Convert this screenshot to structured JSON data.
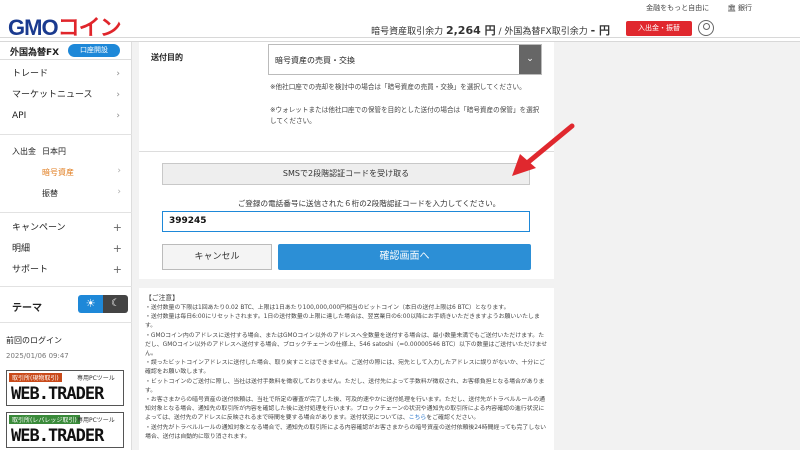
{
  "header": {
    "logo_gmo": "GMO",
    "logo_coin": "コイン",
    "top_links": [
      "金融をもっと自由に",
      "銀行"
    ],
    "balance_label_1": "暗号資産取引余力",
    "balance_value_1": "2,264 円",
    "balance_sep": "/",
    "balance_label_2": "外国為替FX取引余力",
    "balance_value_2": "- 円",
    "deposit_label": "入出金・振替"
  },
  "sidebar": {
    "fx_title": "外国為替FX",
    "open_account": "口座開設",
    "items": [
      "トレード",
      "マーケットニュース",
      "API"
    ],
    "deposit_section": "入出金",
    "deposit_jpy": "日本円",
    "deposit_crypto": "暗号資産",
    "transfer": "振替",
    "campaign": "キャンペーン",
    "statement": "明細",
    "support": "サポート",
    "theme_label": "テーマ",
    "last_login_label": "前回のログイン",
    "last_login_date": "2025/01/06 09:47",
    "banners": [
      {
        "tag": "取引所(現物取引)",
        "pc": "専用PCツール",
        "name": "WEB.TRADER"
      },
      {
        "tag": "取引所(レバレッジ取引)",
        "pc": "専用PCツール",
        "name": "WEB.TRADER"
      }
    ]
  },
  "form": {
    "purpose_label": "送付目的",
    "purpose_value": "暗号資産の売買・交換",
    "note_1": "※他社口座での売却を検討中の場合は「暗号資産の売買・交換」を選択してください。",
    "note_2": "※ウォレットまたは他社口座での保管を目的とした送付の場合は「暗号資産の保管」を選択してください。",
    "sms_button": "SMSで2段階認証コードを受け取る",
    "instruction": "ご登録の電話番号に送信された６桁の2段階認証コードを入力してください。",
    "code_value": "399245",
    "cancel_button": "キャンセル",
    "confirm_button": "確認画面へ"
  },
  "notes": {
    "title": "【ご注意】",
    "lines": [
      "・送付数量の下限は1回あたり0.02 BTC、上限は1日あたり100,000,000円相当のビットコイン（本日の送付上限は6 BTC）となります。",
      "・送付数量は毎日6:00にリセットされます。1日の送付数量の上限に達した場合は、翌営業日の6:00以降にお手続きいただきますようお願いいたします。",
      "・GMOコイン内のアドレスに送付する場合、またはGMOコイン以外のアドレスへ全数量を送付する場合は、最小数量未満でもご送付いただけます。ただし、GMOコイン以外のアドレスへ送付する場合、ブロックチェーンの仕様上、546 satoshi（=0.00000546 BTC）以下の数量はご送付いただけません。",
      "・誤ったビットコインアドレスに送付した場合、取り戻すことはできません。ご送付の際には、宛先として入力したアドレスに誤りがないか、十分にご確認をお願い致します。",
      "・ビットコインのご送付に際し、当社は送付手数料を徴収しておりません。ただし、送付先によって手数料が徴収され、お客様負担となる場合があります。",
      "・お客さまからの暗号資産の送付依頼は、当社で所定の審査が完了した後、可及的速やかに送付処理を行います。ただし、送付先がトラベルルールの通知対象となる場合、通知先の取引所が内容を確認した後に送付処理を行います。ブロックチェーンの状況や通知先の取引所による内容確認の進行状況によっては、送付先のアドレスに反映されるまで時間を要する場合があります。送付状況については、",
      "こちら",
      "をご確認ください。",
      "・送付先がトラベルルールの通知対象となる場合で、通知先の取引所による内容確認がお客さまからの暗号資産の送付依頼後24時間経っても完了しない場合、送付は自動的に取り消されます。"
    ]
  },
  "colors": {
    "brand_blue": "#1a3a8f",
    "brand_red": "#e0252b",
    "accent_blue": "#2c8fd6",
    "active_orange": "#e07a1a",
    "arrow_red": "#e0282e"
  }
}
